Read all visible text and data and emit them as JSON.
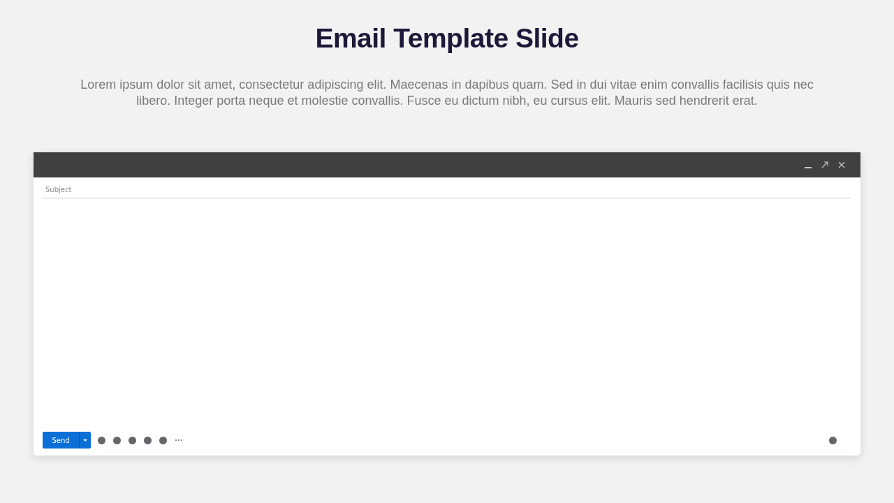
{
  "slide": {
    "title": "Email Template Slide",
    "description": "Lorem ipsum dolor sit amet, consectetur adipiscing elit. Maecenas in dapibus quam. Sed in dui vitae enim convallis facilisis quis nec libero. Integer porta neque et molestie convallis. Fusce eu dictum nibh, eu cursus elit. Mauris sed hendrerit erat."
  },
  "email_window": {
    "subject": {
      "placeholder": "Subject"
    },
    "send_button": {
      "label": "Send"
    }
  }
}
